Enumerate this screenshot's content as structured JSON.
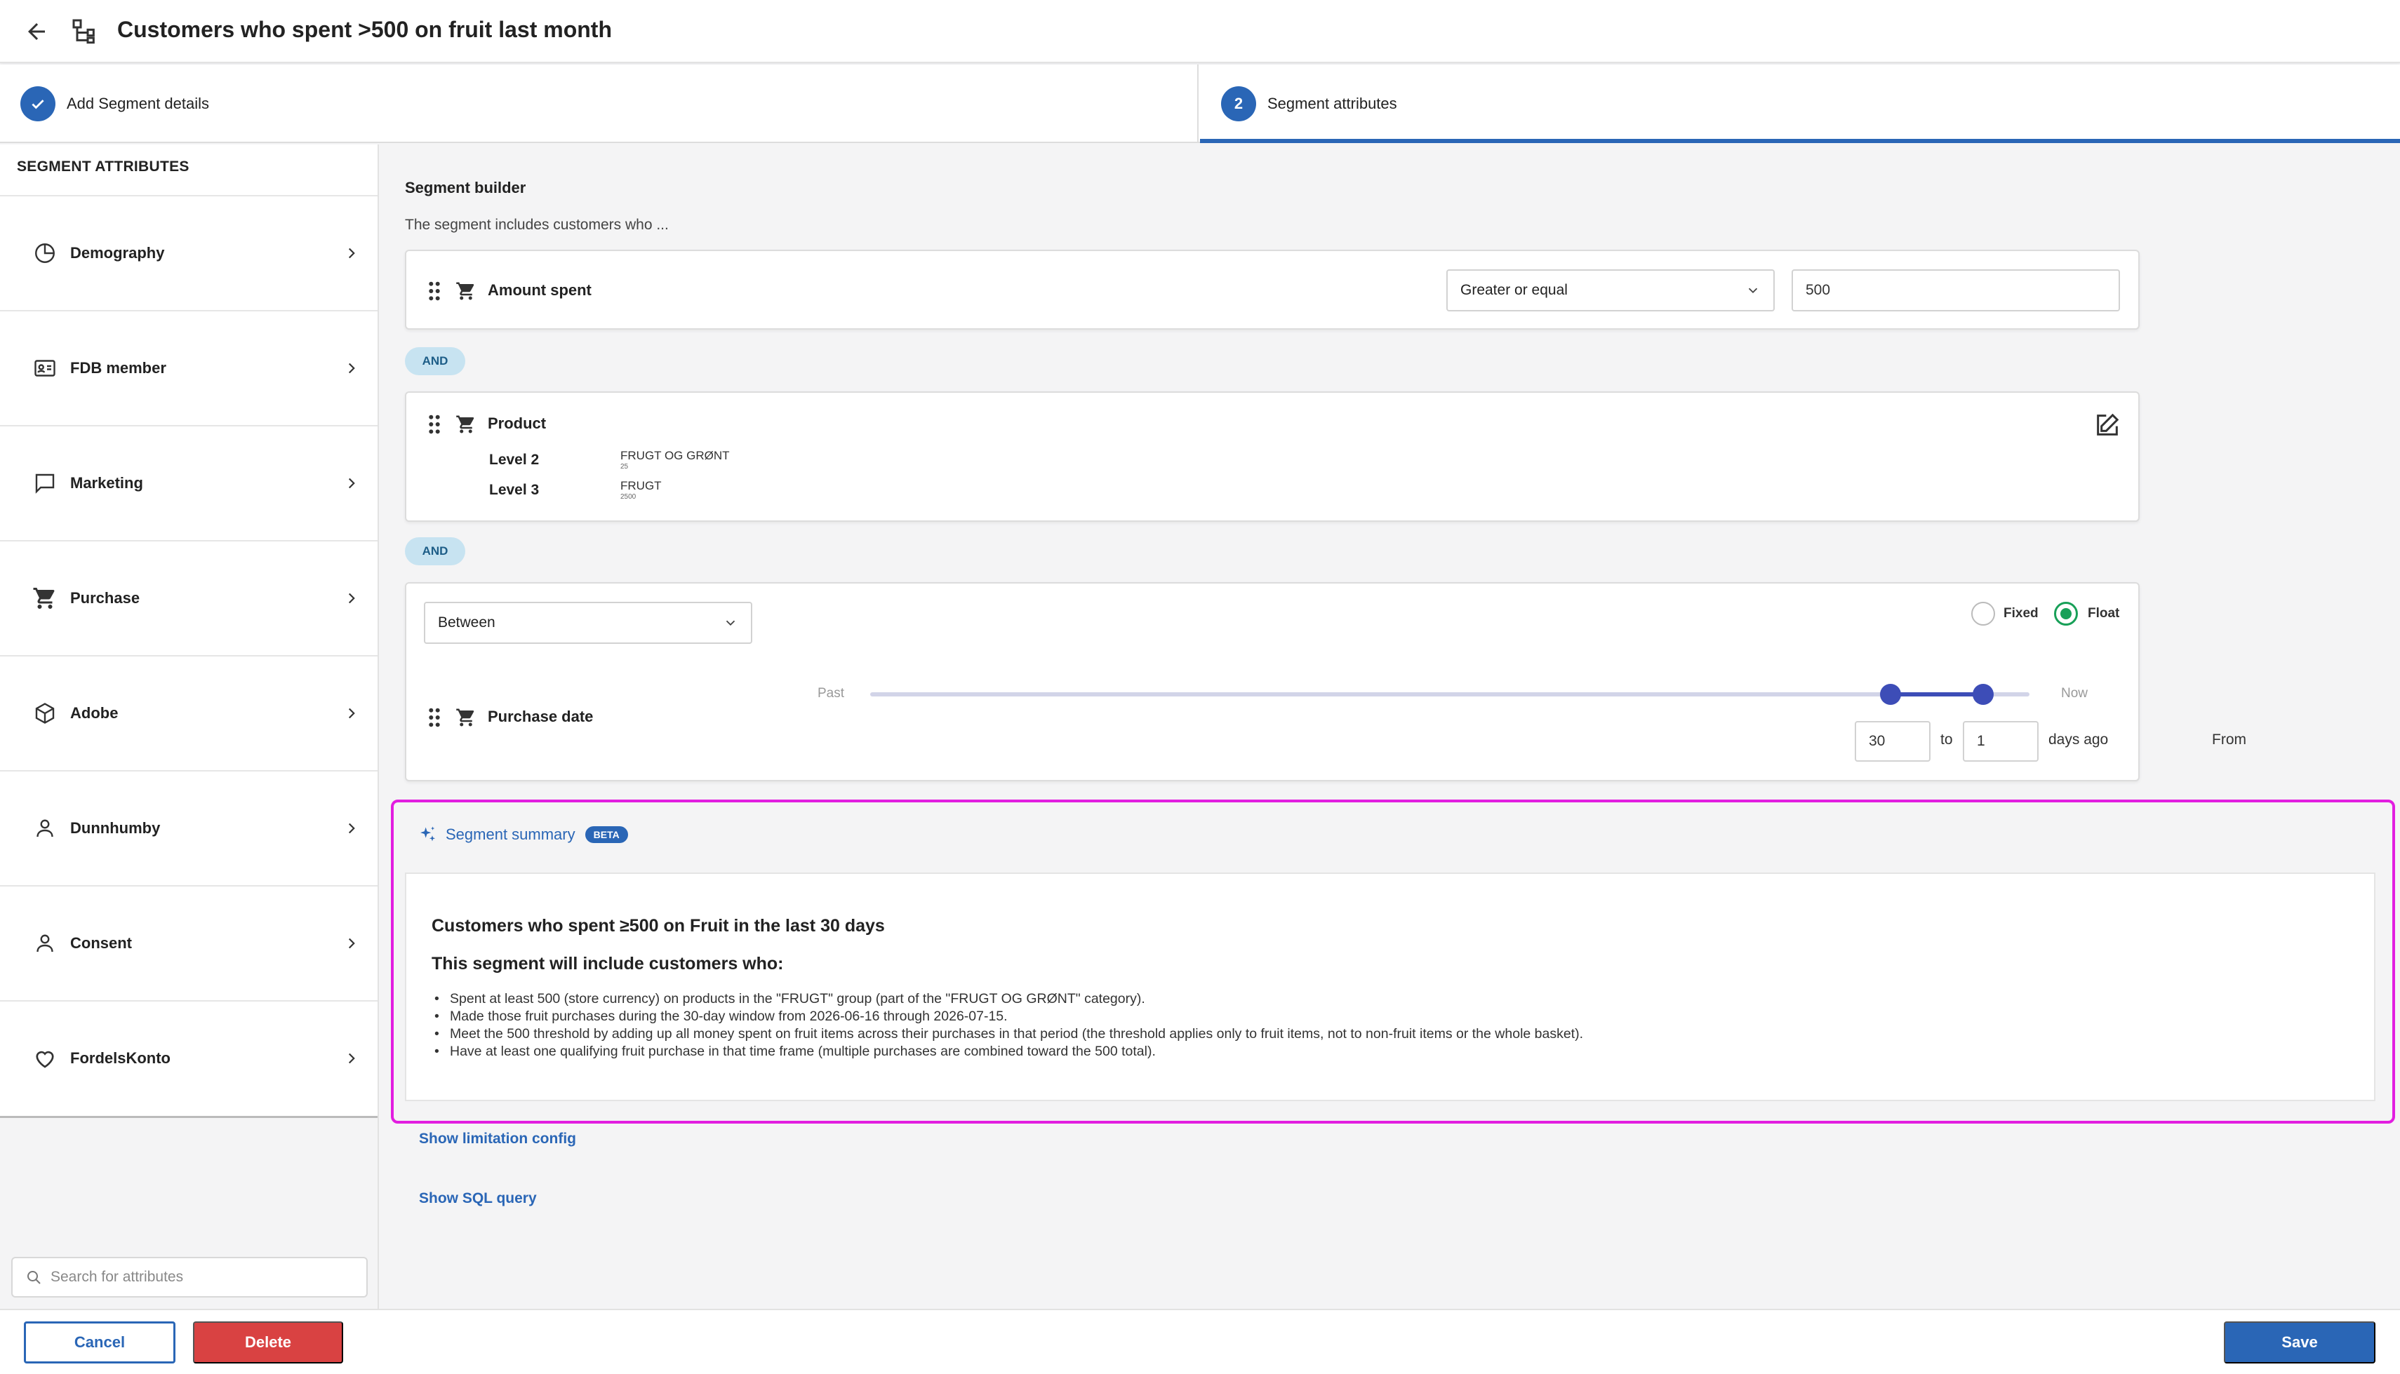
{
  "header": {
    "title": "Customers who spent >500 on fruit last month"
  },
  "steps": [
    {
      "number": "",
      "label": "Add Segment details",
      "status": "done"
    },
    {
      "number": "2",
      "label": "Segment attributes",
      "status": "active"
    }
  ],
  "sidebar": {
    "heading": "SEGMENT ATTRIBUTES",
    "items": [
      {
        "label": "Demography",
        "icon": "pie-chart-icon"
      },
      {
        "label": "FDB member",
        "icon": "id-card-icon"
      },
      {
        "label": "Marketing",
        "icon": "message-icon"
      },
      {
        "label": "Purchase",
        "icon": "cart-icon"
      },
      {
        "label": "Adobe",
        "icon": "cube-icon"
      },
      {
        "label": "Dunnhumby",
        "icon": "person-icon"
      },
      {
        "label": "Consent",
        "icon": "person-icon"
      },
      {
        "label": "FordelsKonto",
        "icon": "heart-icon"
      }
    ],
    "search_placeholder": "Search for attributes"
  },
  "builder": {
    "title": "Segment builder",
    "subtitle": "The segment includes customers who ...",
    "amount": {
      "label": "Amount spent",
      "operator": "Greater or equal",
      "value": "500"
    },
    "and_label": "AND",
    "product": {
      "label": "Product",
      "levels": [
        {
          "label": "Level 2",
          "value": "FRUGT OG GRØNT",
          "code": "25"
        },
        {
          "label": "Level 3",
          "value": "FRUGT",
          "code": "2500"
        }
      ]
    },
    "date": {
      "range_type": "Between",
      "mode_fixed": "Fixed",
      "mode_float": "Float",
      "selected_mode": "Float",
      "label": "Purchase date",
      "past_label": "Past",
      "now_label": "Now",
      "slider_from_fraction": 0.88,
      "slider_to_fraction": 0.96,
      "from_label": "From",
      "from_value": "30",
      "to_label": "to",
      "to_value": "1",
      "suffix": "days ago"
    }
  },
  "summary": {
    "tab_label": "Segment summary",
    "badge": "BETA",
    "heading": "Customers who spent ≥500 on Fruit in the last 30 days",
    "subheading": "This segment will include customers who:",
    "bullets": [
      "Spent at least 500 (store currency) on products in the \"FRUGT\" group (part of the \"FRUGT OG GRØNT\" category).",
      "Made those fruit purchases during the 30-day window from 2026-06-16 through 2026-07-15.",
      "Meet the 500 threshold by adding up all money spent on fruit items across their purchases in that period (the threshold applies only to fruit items, not to non-fruit items or the whole basket).",
      "Have at least one qualifying fruit purchase in that time frame (multiple purchases are combined toward the 500 total)."
    ]
  },
  "links": {
    "limitation": "Show limitation config",
    "sql": "Show SQL query"
  },
  "footer": {
    "cancel": "Cancel",
    "delete": "Delete",
    "save": "Save"
  },
  "colors": {
    "primary": "#2a66b6",
    "danger": "#d94242",
    "float_green": "#18a058",
    "slider": "#3d4db7",
    "highlight": "#e21ee0"
  }
}
